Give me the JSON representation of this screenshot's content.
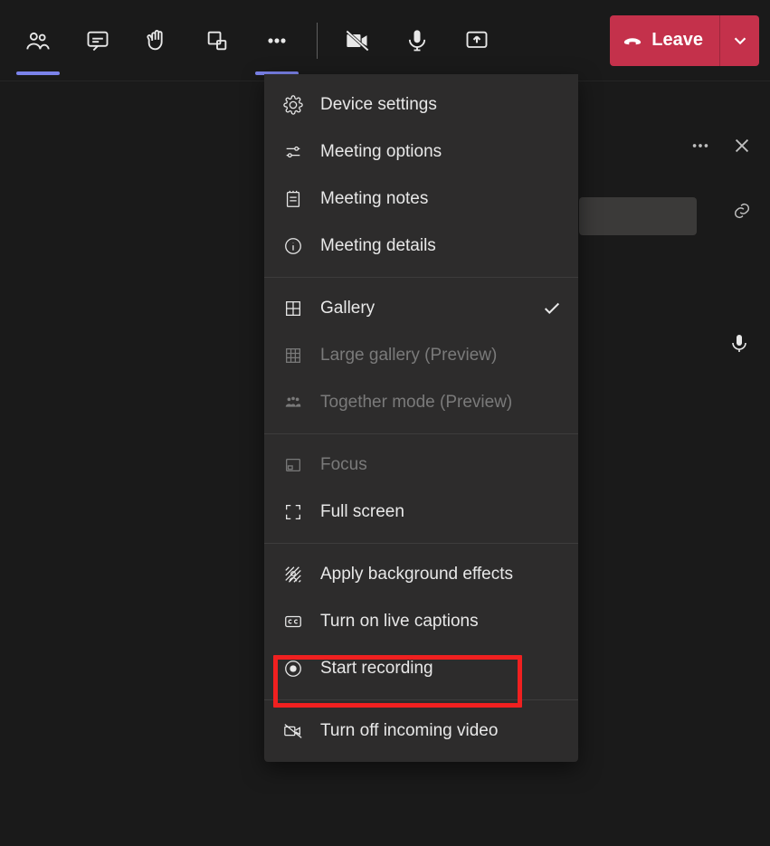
{
  "toolbar": {
    "leave_label": "Leave"
  },
  "dropdown": {
    "settings": {
      "device_settings": "Device settings",
      "meeting_options": "Meeting options",
      "meeting_notes": "Meeting notes",
      "meeting_details": "Meeting details"
    },
    "views": {
      "gallery": "Gallery",
      "large_gallery": "Large gallery (Preview)",
      "together_mode": "Together mode (Preview)"
    },
    "screen": {
      "focus": "Focus",
      "full_screen": "Full screen"
    },
    "actions": {
      "background_effects": "Apply background effects",
      "live_captions": "Turn on live captions",
      "start_recording": "Start recording"
    },
    "video": {
      "turn_off_incoming": "Turn off incoming video"
    }
  },
  "highlight": {
    "target": "live_captions"
  }
}
